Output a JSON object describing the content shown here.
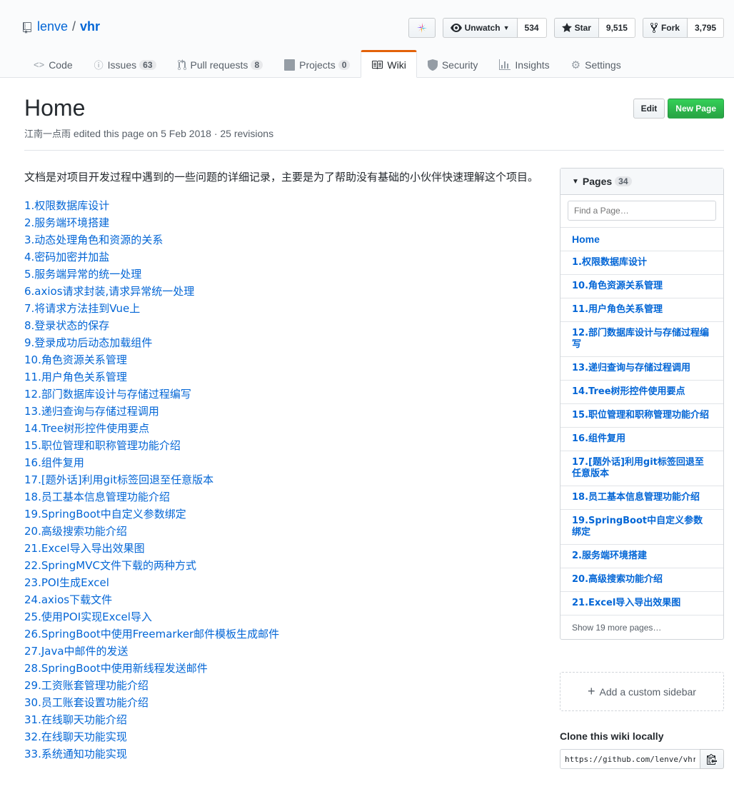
{
  "repo": {
    "owner": "lenve",
    "separator": "/",
    "name": "vhr"
  },
  "actions": {
    "zenhub_icon": "zenhub-logo-icon",
    "watch_label": "Unwatch",
    "watch_count": "534",
    "star_label": "Star",
    "star_count": "9,515",
    "fork_label": "Fork",
    "fork_count": "3,795"
  },
  "nav": {
    "code": "Code",
    "issues": "Issues",
    "issues_count": "63",
    "pulls": "Pull requests",
    "pulls_count": "8",
    "projects": "Projects",
    "projects_count": "0",
    "wiki": "Wiki",
    "security": "Security",
    "insights": "Insights",
    "settings": "Settings"
  },
  "page": {
    "title": "Home",
    "author": "江南一点雨",
    "meta": "edited this page on 5 Feb 2018 · 25 revisions",
    "edit_label": "Edit",
    "new_page_label": "New Page",
    "intro": "文档是对项目开发过程中遇到的一些问题的详细记录，主要是为了帮助没有基础的小伙伴快速理解这个项目。",
    "links": [
      "1.权限数据库设计",
      "2.服务端环境搭建",
      "3.动态处理角色和资源的关系",
      "4.密码加密并加盐",
      "5.服务端异常的统一处理",
      "6.axios请求封装,请求异常统一处理",
      "7.将请求方法挂到Vue上",
      "8.登录状态的保存",
      "9.登录成功后动态加载组件",
      "10.角色资源关系管理",
      "11.用户角色关系管理",
      "12.部门数据库设计与存储过程编写",
      "13.递归查询与存储过程调用",
      "14.Tree树形控件使用要点",
      "15.职位管理和职称管理功能介绍",
      "16.组件复用",
      "17.[题外话]利用git标签回退至任意版本",
      "18.员工基本信息管理功能介绍",
      "19.SpringBoot中自定义参数绑定",
      "20.高级搜索功能介绍",
      "21.Excel导入导出效果图",
      "22.SpringMVC文件下载的两种方式",
      "23.POI生成Excel",
      "24.axios下载文件",
      "25.使用POI实现Excel导入",
      "26.SpringBoot中使用Freemarker邮件模板生成邮件",
      "27.Java中邮件的发送",
      "28.SpringBoot中使用新线程发送邮件",
      "29.工资账套管理功能介绍",
      "30.员工账套设置功能介绍",
      "31.在线聊天功能介绍",
      "32.在线聊天功能实现",
      "33.系统通知功能实现"
    ]
  },
  "sidebar": {
    "pages_label": "Pages",
    "pages_count": "34",
    "filter_placeholder": "Find a Page…",
    "pages": [
      "Home",
      "1.权限数据库设计",
      "10.角色资源关系管理",
      "11.用户角色关系管理",
      "12.部门数据库设计与存储过程编写",
      "13.递归查询与存储过程调用",
      "14.Tree树形控件使用要点",
      "15.职位管理和职称管理功能介绍",
      "16.组件复用",
      "17.[题外话]利用git标签回退至任意版本",
      "18.员工基本信息管理功能介绍",
      "19.SpringBoot中自定义参数绑定",
      "2.服务端环境搭建",
      "20.高级搜索功能介绍",
      "21.Excel导入导出效果图"
    ],
    "show_more": "Show 19 more pages…",
    "custom_sidebar": "Add a custom sidebar",
    "clone_title": "Clone this wiki locally",
    "clone_url": "https://github.com/lenve/vhr.wiki.git"
  }
}
